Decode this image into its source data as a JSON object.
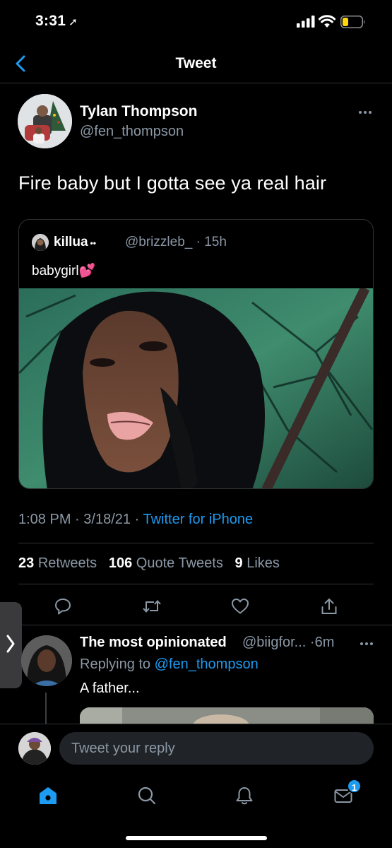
{
  "status_bar": {
    "time": "3:31",
    "location_arrow": "location-arrow-icon"
  },
  "nav": {
    "title": "Tweet",
    "back_icon": "chevron-left-icon"
  },
  "tweet": {
    "author_name": "Tylan Thompson",
    "author_handle": "@fen_thompson",
    "text": "Fire baby but I gotta see ya real hair",
    "quote": {
      "name": "killua",
      "name_suffix": "••",
      "handle": "@brizzleb_",
      "time": "· 15h",
      "text": "babygirl",
      "emoji": "💕"
    },
    "time": "1:08 PM",
    "date": "3/18/21",
    "source": "Twitter for iPhone",
    "stats": {
      "retweets_count": "23",
      "retweets_label": "Retweets",
      "quotes_count": "106",
      "quotes_label": "Quote Tweets",
      "likes_count": "9",
      "likes_label": "Likes"
    }
  },
  "reply": {
    "name": "The most opinionated",
    "handle": "@biigfor...",
    "time": "·6m",
    "replying_to_label": "Replying to",
    "replying_to_handle": "@fen_thompson",
    "text": "A father..."
  },
  "composer": {
    "placeholder": "Tweet your reply"
  },
  "tabs": {
    "notification_badge": "1"
  },
  "colors": {
    "accent": "#1d9bf0",
    "muted": "#8b98a5",
    "divider": "#2f3336",
    "background": "#000000"
  }
}
